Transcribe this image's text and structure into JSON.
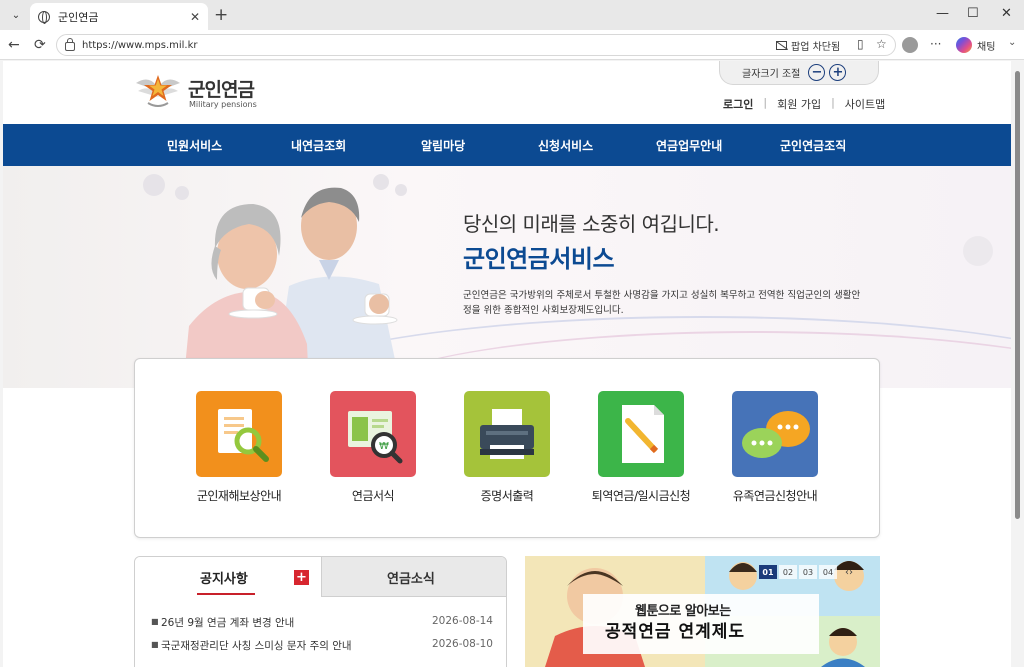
{
  "browser": {
    "tab_title": "군인연금",
    "url": "https://www.mps.mil.kr",
    "popup_blocked": "팝업 차단됨",
    "chat_label": "채팅"
  },
  "header": {
    "logo_title": "군인연금",
    "logo_subtitle": "Military pensions",
    "font_size_label": "글자크기 조절",
    "font_minus": "−",
    "font_plus": "+",
    "util_links": [
      "로그인",
      "회원 가입",
      "사이트맵"
    ]
  },
  "nav": {
    "items": [
      "민원서비스",
      "내연금조회",
      "알림마당",
      "신청서비스",
      "연금업무안내",
      "군인연금조직"
    ]
  },
  "hero": {
    "heading": "당신의 미래를 소중히 여깁니다.",
    "title": "군인연금서비스",
    "description": "군인연금은 국가방위의 주체로서 투철한 사명감을 가지고 성실히 복무하고 전역한 직업군인의 생활안정을 위한 종합적인 사회보장제도입니다."
  },
  "quick_menu": {
    "items": [
      {
        "label": "군인재해보상안내",
        "color": "#f2901c"
      },
      {
        "label": "연금서식",
        "color": "#e3545d"
      },
      {
        "label": "증명서출력",
        "color": "#a5c33a"
      },
      {
        "label": "퇴역연금/일시금신청",
        "color": "#3cb549"
      },
      {
        "label": "유족연금신청안내",
        "color": "#4673b8"
      }
    ]
  },
  "notice": {
    "tab_active": "공지사항",
    "tab_inactive": "연금소식",
    "more": "+",
    "rows": [
      {
        "title": "26년 9월 연금 계좌 변경 안내",
        "date": "2026-08-14"
      },
      {
        "title": "국군재정관리단 사칭 스미싱 문자 주의 안내",
        "date": "2026-08-10"
      }
    ]
  },
  "banner": {
    "line1": "웹툰으로 알아보는",
    "line2": "공적연금 연계제도",
    "pages": [
      "01",
      "02",
      "03",
      "04"
    ],
    "prev": "‹",
    "next": "›"
  }
}
